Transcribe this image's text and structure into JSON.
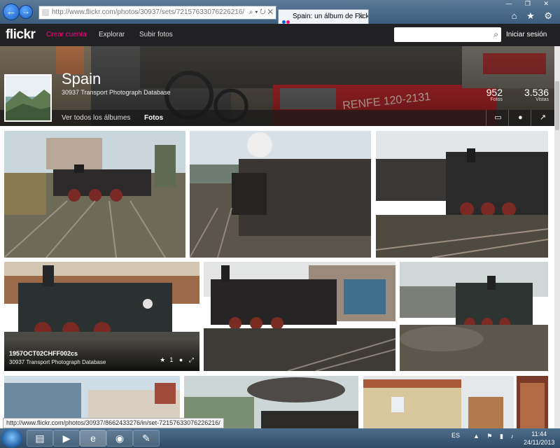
{
  "browser": {
    "address": "http://www.flickr.com/photos/30937/sets/72157633076226216/",
    "tab_title": "Spain: un álbum de Flickr",
    "window_controls": "— ❐ ✕",
    "tool_icons": "⌂ ★ ⚙",
    "addr_controls": "⌕ ▾ ↻ ✕"
  },
  "flickr": {
    "logo": "flickr",
    "nav": [
      "Crear cuenta",
      "Explorar",
      "Subir fotos"
    ],
    "search_placeholder": "",
    "login": "Iniciar sesión",
    "colors": {
      "brand_pink": "#ff0084",
      "brand_blue": "#0063dc",
      "bar": "#212124"
    }
  },
  "album": {
    "title": "Spain",
    "owner": "30937 Transport Photograph Database",
    "tab_all": "Ver todos los álbumes",
    "tab_photos": "Fotos",
    "stats": [
      {
        "num": "952",
        "label": "Fotos"
      },
      {
        "num": "3.536",
        "label": "Vistas"
      }
    ],
    "action_icons": [
      "slideshow-icon",
      "comment-icon",
      "share-icon"
    ]
  },
  "photos": [
    {
      "title": "",
      "author": ""
    },
    {
      "title": "",
      "author": ""
    },
    {
      "title": "",
      "author": ""
    },
    {
      "title": "1957OCT02CHFF002cs",
      "author": "30937 Transport Photograph Database",
      "faves": "1"
    },
    {
      "title": "",
      "author": ""
    },
    {
      "title": "",
      "author": ""
    },
    {
      "title": "",
      "author": ""
    },
    {
      "title": "",
      "author": ""
    },
    {
      "title": "",
      "author": ""
    }
  ],
  "status_bar": "http://www.flickr.com/photos/30937/8662433276/in/set-72157633076226216/",
  "taskbar": {
    "language": "ES",
    "time": "11:44",
    "date": "24/11/2013",
    "tray_icons": "▲ ⚑ ▮ ♪"
  }
}
